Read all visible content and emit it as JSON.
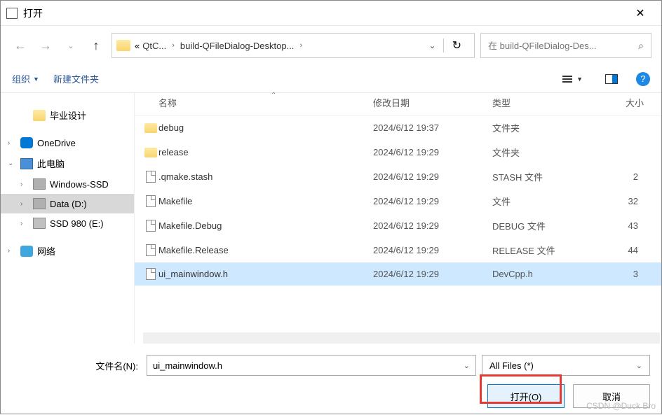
{
  "window": {
    "title": "打开"
  },
  "breadcrumb": {
    "prefix": "«",
    "items": [
      "QtC...",
      "build-QFileDialog-Desktop..."
    ]
  },
  "search": {
    "placeholder": "在 build-QFileDialog-Des..."
  },
  "toolbar": {
    "organize": "组织",
    "newfolder": "新建文件夹"
  },
  "sidebar": {
    "items": [
      {
        "label": "毕业设计",
        "icon": "icon-folder-yellow",
        "indent": 1,
        "has_children": false
      },
      {
        "label": "OneDrive",
        "icon": "icon-onedrive",
        "indent": 0,
        "has_children": true
      },
      {
        "label": "此电脑",
        "icon": "icon-pc",
        "indent": 0,
        "has_children": true,
        "expanded": true
      },
      {
        "label": "Windows-SSD",
        "icon": "icon-drive",
        "indent": 1,
        "has_children": true
      },
      {
        "label": "Data (D:)",
        "icon": "icon-drive",
        "indent": 1,
        "has_children": true,
        "selected": true
      },
      {
        "label": "SSD  980 (E:)",
        "icon": "icon-ssd",
        "indent": 1,
        "has_children": true
      },
      {
        "label": "网络",
        "icon": "icon-network",
        "indent": 0,
        "has_children": true
      }
    ]
  },
  "columns": {
    "name": "名称",
    "date": "修改日期",
    "type": "类型",
    "size": "大小"
  },
  "files": [
    {
      "name": "debug",
      "date": "2024/6/12 19:37",
      "type": "文件夹",
      "size": "",
      "kind": "folder"
    },
    {
      "name": "release",
      "date": "2024/6/12 19:29",
      "type": "文件夹",
      "size": "",
      "kind": "folder"
    },
    {
      "name": ".qmake.stash",
      "date": "2024/6/12 19:29",
      "type": "STASH 文件",
      "size": "2",
      "kind": "file"
    },
    {
      "name": "Makefile",
      "date": "2024/6/12 19:29",
      "type": "文件",
      "size": "32",
      "kind": "file"
    },
    {
      "name": "Makefile.Debug",
      "date": "2024/6/12 19:29",
      "type": "DEBUG 文件",
      "size": "43",
      "kind": "file"
    },
    {
      "name": "Makefile.Release",
      "date": "2024/6/12 19:29",
      "type": "RELEASE 文件",
      "size": "44",
      "kind": "file"
    },
    {
      "name": "ui_mainwindow.h",
      "date": "2024/6/12 19:29",
      "type": "DevCpp.h",
      "size": "3",
      "kind": "file",
      "selected": true
    }
  ],
  "footer": {
    "filename_label": "文件名(N):",
    "filename_value": "ui_mainwindow.h",
    "filter": "All Files  (*)",
    "open": "打开(O)",
    "cancel": "取消"
  },
  "watermark": "CSDN @Duck Bro"
}
